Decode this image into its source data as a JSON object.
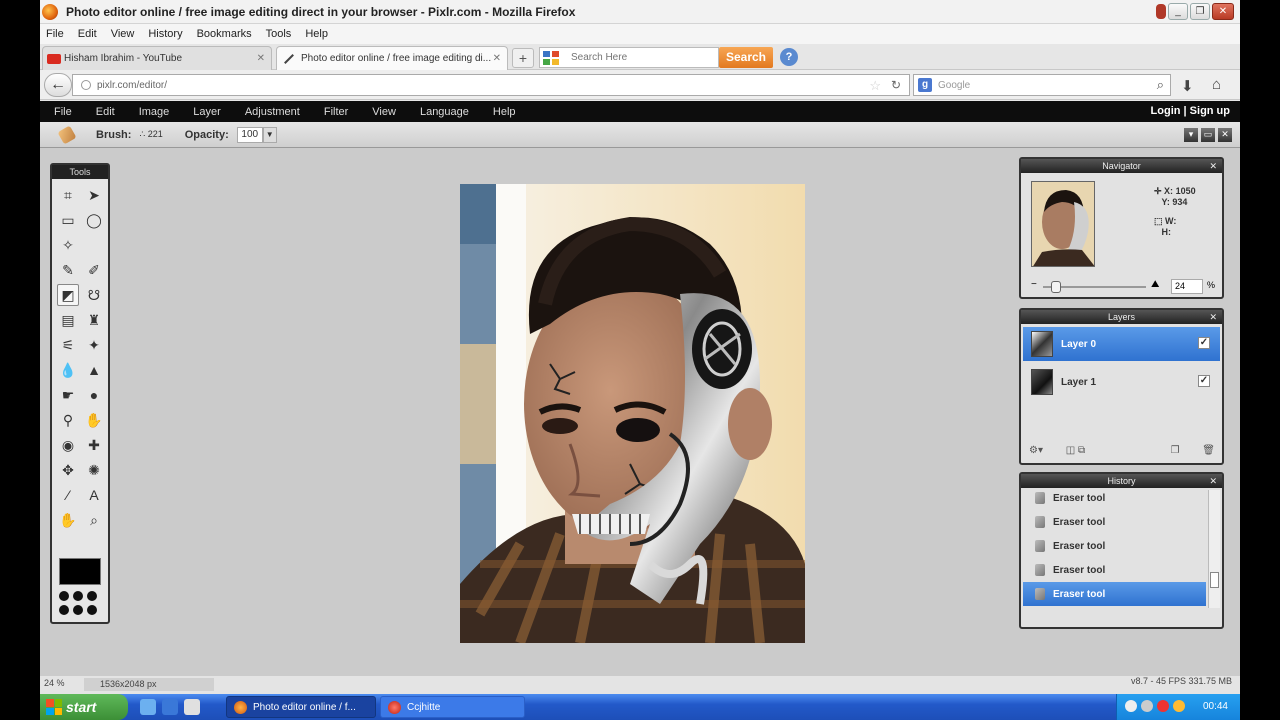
{
  "window": {
    "title": "Photo editor online / free image editing direct in your browser - Pixlr.com - Mozilla Firefox"
  },
  "browser_menu": [
    "File",
    "Edit",
    "View",
    "History",
    "Bookmarks",
    "Tools",
    "Help"
  ],
  "tabs": [
    {
      "label": "Hisham Ibrahim - YouTube",
      "active": false
    },
    {
      "label": "Photo editor online / free image editing di...",
      "active": true
    }
  ],
  "toolbar_search": {
    "placeholder": "Search Here",
    "button": "Search"
  },
  "nav": {
    "url": "pixlr.com/editor/",
    "search_engine_placeholder": "Google"
  },
  "pixlr_menu": [
    "File",
    "Edit",
    "Image",
    "Layer",
    "Adjustment",
    "Filter",
    "View",
    "Language",
    "Help"
  ],
  "account": {
    "login": "Login",
    "divider": "|",
    "signup": "Sign up"
  },
  "options": {
    "brush_label": "Brush:",
    "brush_size": "221",
    "opacity_label": "Opacity:",
    "opacity_value": "100"
  },
  "panels": {
    "tools_title": "Tools",
    "navigator_title": "Navigator",
    "layers_title": "Layers",
    "history_title": "History"
  },
  "navigator": {
    "x_label": "X:",
    "x_value": "1050",
    "y_label": "Y:",
    "y_value": "934",
    "w_label": "W:",
    "h_label": "H:",
    "zoom": "24",
    "zoom_unit": "%"
  },
  "layers": [
    {
      "name": "Layer 0",
      "active": true,
      "visible": true
    },
    {
      "name": "Layer 1",
      "active": false,
      "visible": true
    }
  ],
  "history": [
    {
      "label": "Eraser tool",
      "active": false
    },
    {
      "label": "Eraser tool",
      "active": false
    },
    {
      "label": "Eraser tool",
      "active": false
    },
    {
      "label": "Eraser tool",
      "active": false
    },
    {
      "label": "Eraser tool",
      "active": true
    }
  ],
  "status": {
    "zoom": "24",
    "zoom_unit": "%",
    "image_size": "1536x2048 px",
    "version_fps": "v8.7 - 45 FPS 331.75 MB"
  },
  "taskbar": {
    "start": "start",
    "items": [
      {
        "label": "Photo editor online / f...",
        "active": true
      },
      {
        "label": "Ccjhitte",
        "active": false
      }
    ],
    "clock": "00:44"
  },
  "colors": {
    "accent_blue": "#2f72d0",
    "pixlr_menu_bg": "#0d0d0d",
    "search_orange": "#e3791f",
    "xp_taskbar": "#2359c9"
  }
}
